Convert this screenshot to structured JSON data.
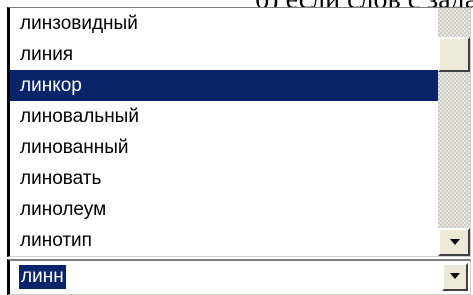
{
  "caption": "б) если слов с заданным",
  "list": {
    "items": [
      {
        "label": "линзовидный"
      },
      {
        "label": "линия"
      },
      {
        "label": "линкор"
      },
      {
        "label": "линовальный"
      },
      {
        "label": "линованный"
      },
      {
        "label": "линовать"
      },
      {
        "label": "линолеум"
      },
      {
        "label": "линотип"
      }
    ],
    "selected_index": 2
  },
  "combo": {
    "value": "линн"
  },
  "colors": {
    "selection": "#0a246a",
    "button_face": "#ece9d8"
  },
  "icons": {
    "scroll_down": "down-arrow-icon",
    "dropdown": "dropdown-arrow-icon"
  }
}
